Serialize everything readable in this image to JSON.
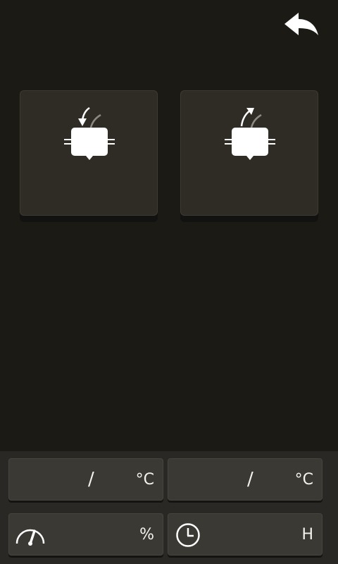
{
  "header": {
    "back_icon": "back-arrow-icon"
  },
  "tiles": [
    {
      "icon": "device-inflow-arrow-icon"
    },
    {
      "icon": "device-outflow-arrow-icon"
    }
  ],
  "status": {
    "temp_left": {
      "separator": "/",
      "unit": "°C"
    },
    "temp_right": {
      "separator": "/",
      "unit": "°C"
    },
    "speed": {
      "icon": "gauge-icon",
      "unit": "%"
    },
    "time": {
      "icon": "clock-icon",
      "unit": "H"
    }
  }
}
